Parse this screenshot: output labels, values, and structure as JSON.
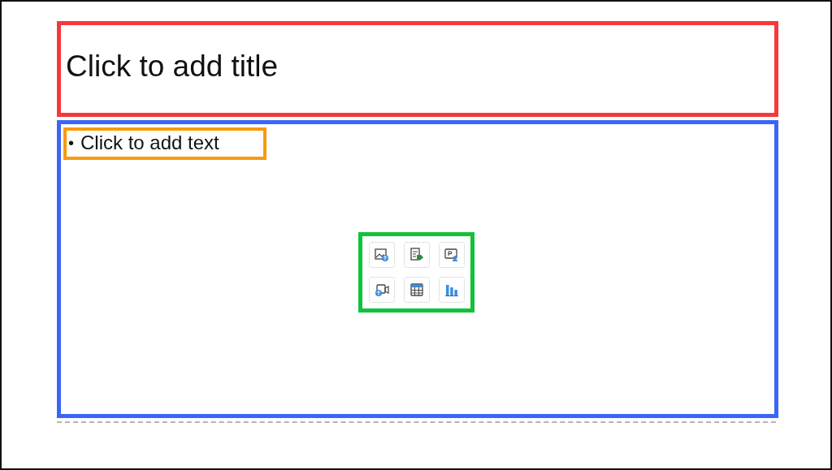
{
  "title_placeholder": {
    "text": "Click to add title"
  },
  "content_placeholder": {
    "bullet": "•",
    "text": "Click to add text",
    "insert_icons": [
      {
        "kind": "picture"
      },
      {
        "kind": "document"
      },
      {
        "kind": "presenter"
      },
      {
        "kind": "video"
      },
      {
        "kind": "table"
      },
      {
        "kind": "chart"
      }
    ]
  }
}
